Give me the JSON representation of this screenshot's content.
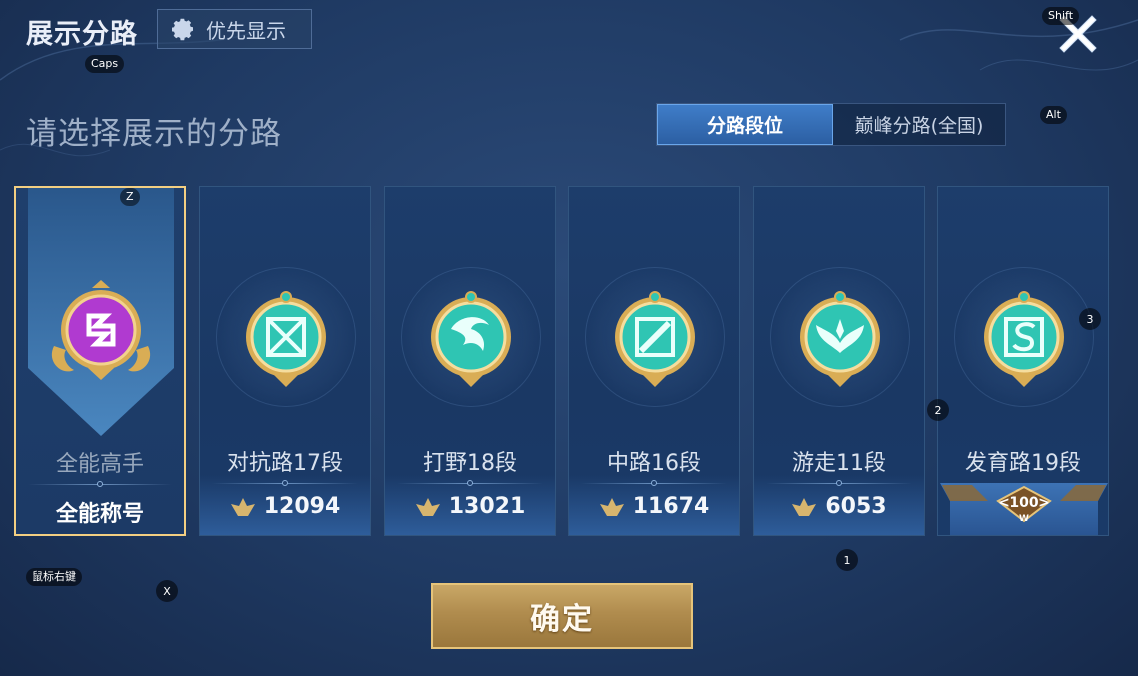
{
  "header": {
    "title": "展示分路",
    "priority_label": "优先显示"
  },
  "prompt": "请选择展示的分路",
  "tabs": [
    {
      "label": "分路段位",
      "active": true
    },
    {
      "label": "巅峰分路(全国)",
      "active": false
    }
  ],
  "cards": [
    {
      "name": "全能高手",
      "title": "全能称号",
      "medal": "purple-omni-medal-icon",
      "selected": true
    },
    {
      "name": "对抗路17段",
      "score": "12094",
      "medal": "clash-lane-medal-icon"
    },
    {
      "name": "打野18段",
      "score": "13021",
      "medal": "jungle-dragon-medal-icon"
    },
    {
      "name": "中路16段",
      "score": "11674",
      "medal": "mid-lane-medal-icon"
    },
    {
      "name": "游走11段",
      "score": "6053",
      "medal": "roam-wings-medal-icon"
    },
    {
      "name": "发育路19段",
      "badge_text": "100",
      "badge_sub": "W",
      "medal": "farm-lane-medal-icon"
    }
  ],
  "confirm_label": "确定",
  "key_hints": {
    "shift": "Shift",
    "caps": "Caps",
    "alt": "Alt",
    "z": "Z",
    "x": "X",
    "right_click": "鼠标右键",
    "k1": "1",
    "k2": "2",
    "k3": "3"
  },
  "colors": {
    "background": "#1f3a63",
    "selected_border": "#f3cf82",
    "active_tab": "#3f7dc8",
    "confirm_button": "#b08c4e",
    "medal_teal": "#2fc5b3",
    "medal_purple": "#b03ad0",
    "medal_gold": "#d9ad55"
  }
}
